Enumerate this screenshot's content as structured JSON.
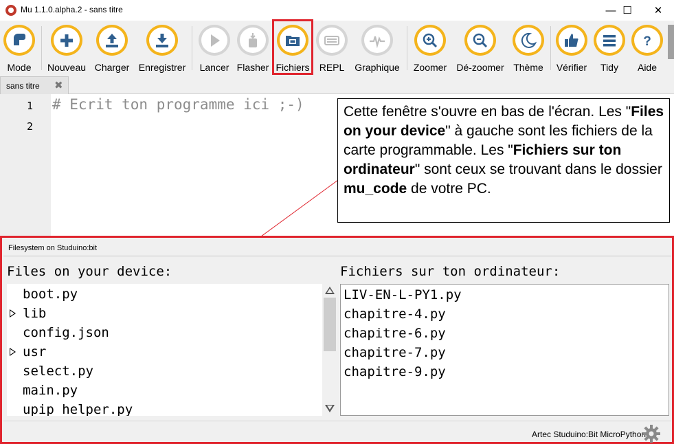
{
  "window": {
    "title": "Mu 1.1.0.alpha.2 - sans titre",
    "minimize": "—",
    "maximize": "☐",
    "close": "✕"
  },
  "toolbar": {
    "buttons": [
      {
        "label": "Mode",
        "icon": "mode-icon"
      },
      {
        "label": "Nouveau",
        "icon": "plus-icon"
      },
      {
        "label": "Charger",
        "icon": "upload-icon"
      },
      {
        "label": "Enregistrer",
        "icon": "download-icon"
      },
      {
        "label": "Lancer",
        "icon": "play-icon"
      },
      {
        "label": "Flasher",
        "icon": "flash-icon"
      },
      {
        "label": "Fichiers",
        "icon": "files-icon"
      },
      {
        "label": "REPL",
        "icon": "keyboard-icon"
      },
      {
        "label": "Graphique",
        "icon": "plotter-icon"
      },
      {
        "label": "Zoomer",
        "icon": "zoom-in-icon"
      },
      {
        "label": "Dé-zoomer",
        "icon": "zoom-out-icon"
      },
      {
        "label": "Thème",
        "icon": "moon-icon"
      },
      {
        "label": "Vérifier",
        "icon": "thumbs-up-icon"
      },
      {
        "label": "Tidy",
        "icon": "tidy-icon"
      },
      {
        "label": "Aide",
        "icon": "help-icon"
      }
    ],
    "accent_color": "#f4b41c",
    "highlight_color": "#e0252e"
  },
  "tabs": [
    {
      "label": "sans titre",
      "close": "✖"
    }
  ],
  "editor": {
    "line_numbers": [
      "1",
      "2"
    ],
    "code_line_1": "# Ecrit ton programme ici ;-)"
  },
  "callout": {
    "p1": "Cette fenêtre s'ouvre en bas de l'écran. Les \"",
    "b1": "Files on your device",
    "p2": "\" à gauche sont les fichiers de la carte programmable. Les \"",
    "b2": "Fichiers sur ton ordinateur",
    "p3": "\" sont ceux se trouvant dans le dossier ",
    "b3": "mu_code",
    "p4": " de votre PC."
  },
  "filesystem": {
    "pane_title": "Filesystem on Studuino:bit",
    "device_heading": "Files on your device:",
    "local_heading": "Fichiers sur ton ordinateur:",
    "device_files": [
      {
        "name": "boot.py",
        "folder": false
      },
      {
        "name": "lib",
        "folder": true
      },
      {
        "name": "config.json",
        "folder": false
      },
      {
        "name": "usr",
        "folder": true
      },
      {
        "name": "select.py",
        "folder": false
      },
      {
        "name": "main.py",
        "folder": false
      },
      {
        "name": "upip_helper.py",
        "folder": false
      }
    ],
    "local_files": [
      "LIV-EN-L-PY1.py",
      "chapitre-4.py",
      "chapitre-6.py",
      "chapitre-7.py",
      "chapitre-9.py"
    ]
  },
  "status": {
    "mode_text": "Artec Studuino:Bit MicroPython",
    "gear_icon": "gear-icon"
  }
}
